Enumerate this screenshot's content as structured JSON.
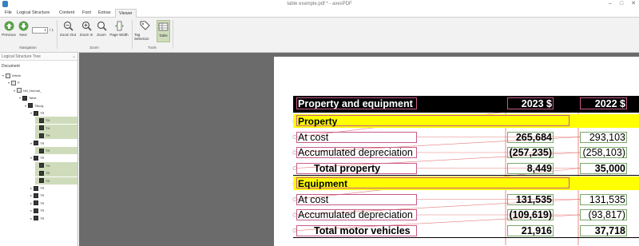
{
  "window": {
    "title": "table example.pdf * - axesPDF",
    "controls": [
      "–",
      "□",
      "✕"
    ]
  },
  "menu": {
    "items": [
      "File",
      "Logical Structure",
      "Content",
      "Font",
      "Extras",
      "Viewer"
    ],
    "active": "Viewer"
  },
  "ribbon": {
    "navigation": {
      "previous": "Previous",
      "next": "Next",
      "page_value": "1",
      "page_total": "/ 1",
      "group": "Navigation"
    },
    "zoom": {
      "zoom_out": "Zoom Out",
      "zoom_in": "Zoom In",
      "zoom": "Zoom",
      "page_width": "Page Width",
      "group": "Zoom"
    },
    "tools": {
      "tag_selection": "Tag Selection",
      "table": "Table",
      "group": "Tools",
      "active": "Table"
    }
  },
  "left_panel": {
    "header": "Logical Structure Tree",
    "root": "Document",
    "nodes": [
      {
        "label": "Article",
        "level": 0
      },
      {
        "label": "P",
        "level": 1
      },
      {
        "label": "NN_Normal_",
        "level": 2
      },
      {
        "label": "Table",
        "level": 3
      },
      {
        "label": "TBody",
        "level": 4
      },
      {
        "label": "TR",
        "level": 5
      },
      {
        "label": "TH",
        "level": 6
      },
      {
        "label": "TH",
        "level": 6
      },
      {
        "label": "TH",
        "level": 6
      },
      {
        "label": "TR",
        "level": 5
      },
      {
        "label": "TH",
        "level": 6
      },
      {
        "label": "TR",
        "level": 5
      },
      {
        "label": "TH",
        "level": 6
      },
      {
        "label": "TD",
        "level": 6
      },
      {
        "label": "TD",
        "level": 6
      },
      {
        "label": "TR",
        "level": 5
      },
      {
        "label": "TR",
        "level": 5
      },
      {
        "label": "TR",
        "level": 5
      },
      {
        "label": "TR",
        "level": 5
      },
      {
        "label": "TR",
        "level": 5
      }
    ]
  },
  "document": {
    "header": {
      "label": "Property and equipment",
      "col1": "2023 $",
      "col2": "2022 $"
    },
    "rows": [
      {
        "label": "Property",
        "section": true,
        "v1": "",
        "v2": ""
      },
      {
        "label": "At cost",
        "v1": "265,684",
        "v2": "293,103"
      },
      {
        "label": "Accumulated depreciation",
        "v1": "(257,235)",
        "v2": "(258,103)"
      },
      {
        "label": "Total property",
        "total": true,
        "v1": "8,449",
        "v2": "35,000"
      },
      {
        "label": "Equipment",
        "section": true,
        "v1": "",
        "v2": ""
      },
      {
        "label": "At cost",
        "v1": "131,535",
        "v2": "131,535"
      },
      {
        "label": "Accumulated depreciation",
        "v1": "(109,619)",
        "v2": "(93,817)"
      },
      {
        "label": "Total motor vehicles",
        "total": true,
        "v1": "21,916",
        "v2": "37,718"
      }
    ]
  },
  "colors": {
    "accent": "#cfdcbc",
    "header_fill": "#000000",
    "section_fill": "#ffff00",
    "tag_box": "#c85a8a",
    "reading_order_line": "#e05a5a"
  }
}
